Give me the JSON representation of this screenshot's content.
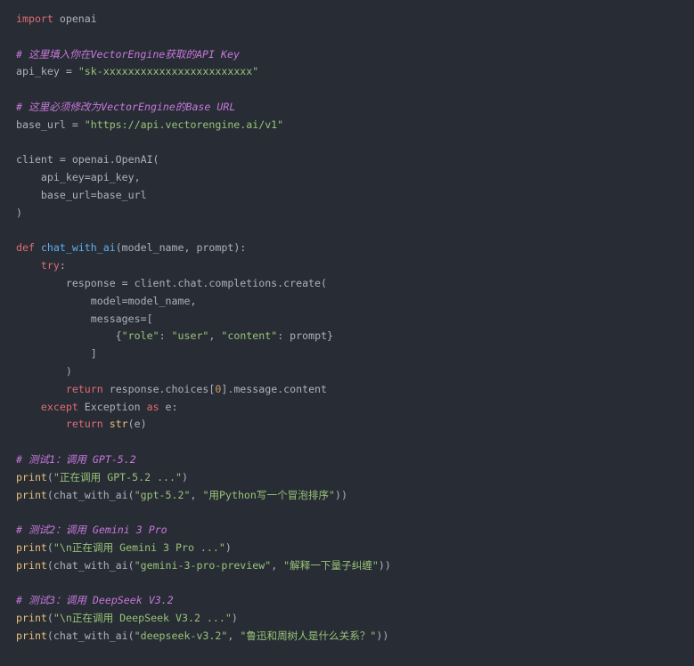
{
  "code": {
    "lines": [
      [
        {
          "t": "kw",
          "v": "import"
        },
        {
          "t": "txt",
          "v": " openai"
        }
      ],
      [],
      [
        {
          "t": "cmt",
          "v": "# 这里填入你在VectorEngine获取的API Key"
        }
      ],
      [
        {
          "t": "txt",
          "v": "api_key = "
        },
        {
          "t": "str",
          "v": "\"sk-xxxxxxxxxxxxxxxxxxxxxxxx\""
        }
      ],
      [],
      [
        {
          "t": "cmt",
          "v": "# 这里必须修改为VectorEngine的Base URL"
        }
      ],
      [
        {
          "t": "txt",
          "v": "base_url = "
        },
        {
          "t": "str",
          "v": "\"https://api.vectorengine.ai/v1\""
        }
      ],
      [],
      [
        {
          "t": "txt",
          "v": "client = openai.OpenAI("
        }
      ],
      [
        {
          "t": "txt",
          "v": "    api_key=api_key,"
        }
      ],
      [
        {
          "t": "txt",
          "v": "    base_url=base_url"
        }
      ],
      [
        {
          "t": "txt",
          "v": ")"
        }
      ],
      [],
      [
        {
          "t": "kw",
          "v": "def"
        },
        {
          "t": "txt",
          "v": " "
        },
        {
          "t": "fn",
          "v": "chat_with_ai"
        },
        {
          "t": "txt",
          "v": "(model_name, prompt):"
        }
      ],
      [
        {
          "t": "txt",
          "v": "    "
        },
        {
          "t": "kw",
          "v": "try"
        },
        {
          "t": "txt",
          "v": ":"
        }
      ],
      [
        {
          "t": "txt",
          "v": "        response = client.chat.completions.create("
        }
      ],
      [
        {
          "t": "txt",
          "v": "            model=model_name,"
        }
      ],
      [
        {
          "t": "txt",
          "v": "            messages=["
        }
      ],
      [
        {
          "t": "txt",
          "v": "                {"
        },
        {
          "t": "str",
          "v": "\"role\""
        },
        {
          "t": "txt",
          "v": ": "
        },
        {
          "t": "str",
          "v": "\"user\""
        },
        {
          "t": "txt",
          "v": ", "
        },
        {
          "t": "str",
          "v": "\"content\""
        },
        {
          "t": "txt",
          "v": ": prompt}"
        }
      ],
      [
        {
          "t": "txt",
          "v": "            ]"
        }
      ],
      [
        {
          "t": "txt",
          "v": "        )"
        }
      ],
      [
        {
          "t": "txt",
          "v": "        "
        },
        {
          "t": "kw",
          "v": "return"
        },
        {
          "t": "txt",
          "v": " response.choices["
        },
        {
          "t": "num",
          "v": "0"
        },
        {
          "t": "txt",
          "v": "].message.content"
        }
      ],
      [
        {
          "t": "txt",
          "v": "    "
        },
        {
          "t": "kw",
          "v": "except"
        },
        {
          "t": "txt",
          "v": " Exception "
        },
        {
          "t": "kw",
          "v": "as"
        },
        {
          "t": "txt",
          "v": " e:"
        }
      ],
      [
        {
          "t": "txt",
          "v": "        "
        },
        {
          "t": "kw",
          "v": "return"
        },
        {
          "t": "txt",
          "v": " "
        },
        {
          "t": "bi",
          "v": "str"
        },
        {
          "t": "txt",
          "v": "(e)"
        }
      ],
      [],
      [
        {
          "t": "cmt",
          "v": "# 测试1：调用 GPT-5.2"
        }
      ],
      [
        {
          "t": "bi",
          "v": "print"
        },
        {
          "t": "txt",
          "v": "("
        },
        {
          "t": "str",
          "v": "\"正在调用 GPT-5.2 ...\""
        },
        {
          "t": "txt",
          "v": ")"
        }
      ],
      [
        {
          "t": "bi",
          "v": "print"
        },
        {
          "t": "txt",
          "v": "(chat_with_ai("
        },
        {
          "t": "str",
          "v": "\"gpt-5.2\""
        },
        {
          "t": "txt",
          "v": ", "
        },
        {
          "t": "str",
          "v": "\"用Python写一个冒泡排序\""
        },
        {
          "t": "txt",
          "v": "))"
        }
      ],
      [],
      [
        {
          "t": "cmt",
          "v": "# 测试2：调用 Gemini 3 Pro"
        }
      ],
      [
        {
          "t": "bi",
          "v": "print"
        },
        {
          "t": "txt",
          "v": "("
        },
        {
          "t": "str",
          "v": "\"\\n正在调用 Gemini 3 Pro ...\""
        },
        {
          "t": "txt",
          "v": ")"
        }
      ],
      [
        {
          "t": "bi",
          "v": "print"
        },
        {
          "t": "txt",
          "v": "(chat_with_ai("
        },
        {
          "t": "str",
          "v": "\"gemini-3-pro-preview\""
        },
        {
          "t": "txt",
          "v": ", "
        },
        {
          "t": "str",
          "v": "\"解释一下量子纠缠\""
        },
        {
          "t": "txt",
          "v": "))"
        }
      ],
      [],
      [
        {
          "t": "cmt",
          "v": "# 测试3：调用 DeepSeek V3.2"
        }
      ],
      [
        {
          "t": "bi",
          "v": "print"
        },
        {
          "t": "txt",
          "v": "("
        },
        {
          "t": "str",
          "v": "\"\\n正在调用 DeepSeek V3.2 ...\""
        },
        {
          "t": "txt",
          "v": ")"
        }
      ],
      [
        {
          "t": "bi",
          "v": "print"
        },
        {
          "t": "txt",
          "v": "(chat_with_ai("
        },
        {
          "t": "str",
          "v": "\"deepseek-v3.2\""
        },
        {
          "t": "txt",
          "v": ", "
        },
        {
          "t": "str",
          "v": "\"鲁迅和周树人是什么关系？\""
        },
        {
          "t": "txt",
          "v": "))"
        }
      ]
    ]
  },
  "colors": {
    "background": "#282c34",
    "keyword": "#e06c75",
    "function": "#61afef",
    "builtin": "#e5c07b",
    "string": "#98c379",
    "comment": "#c678dd",
    "number": "#d19a66",
    "text": "#abb2bf"
  }
}
